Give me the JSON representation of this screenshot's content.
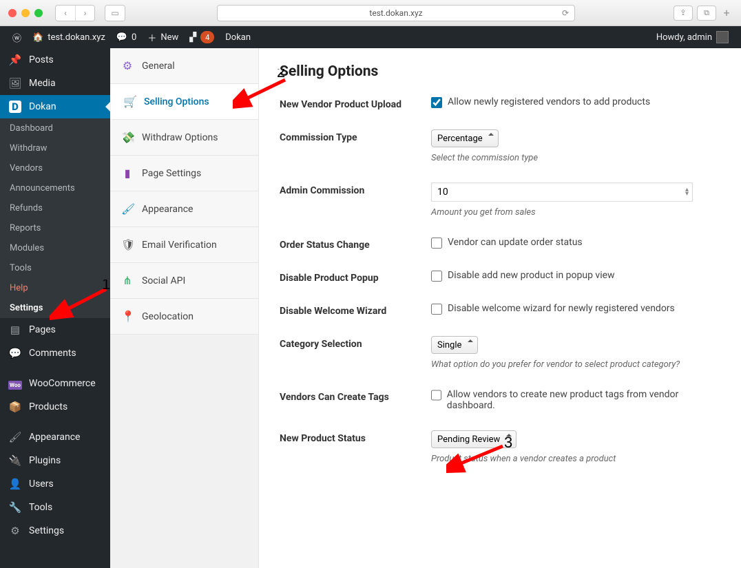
{
  "browser": {
    "url": "test.dokan.xyz"
  },
  "wpbar": {
    "site": "test.dokan.xyz",
    "comments": "0",
    "new": "New",
    "notif": "4",
    "brand": "Dokan",
    "howdy": "Howdy, admin"
  },
  "sidebar": {
    "items": [
      {
        "icon": "📌",
        "label": "Posts"
      },
      {
        "icon": "🖼",
        "label": "Media"
      },
      {
        "icon": "D",
        "label": "Dokan",
        "active": true,
        "sub": [
          {
            "label": "Dashboard"
          },
          {
            "label": "Withdraw"
          },
          {
            "label": "Vendors"
          },
          {
            "label": "Announcements"
          },
          {
            "label": "Refunds"
          },
          {
            "label": "Reports"
          },
          {
            "label": "Modules"
          },
          {
            "label": "Tools"
          },
          {
            "label": "Help",
            "orange": true
          },
          {
            "label": "Settings",
            "active": true
          }
        ]
      },
      {
        "icon": "▤",
        "label": "Pages"
      },
      {
        "icon": "💬",
        "label": "Comments"
      },
      {
        "sep": true
      },
      {
        "icon": "Woo",
        "label": "WooCommerce"
      },
      {
        "icon": "📦",
        "label": "Products"
      },
      {
        "sep": true
      },
      {
        "icon": "🖌",
        "label": "Appearance"
      },
      {
        "icon": "🔌",
        "label": "Plugins"
      },
      {
        "icon": "👤",
        "label": "Users"
      },
      {
        "icon": "🔧",
        "label": "Tools"
      },
      {
        "icon": "⚙",
        "label": "Settings"
      }
    ]
  },
  "tabs": [
    {
      "icon": "⚙",
      "color": "#8a63d2",
      "label": "General"
    },
    {
      "icon": "🛒",
      "color": "#0073aa",
      "label": "Selling Options",
      "active": true
    },
    {
      "icon": "💸",
      "color": "#f05025",
      "label": "Withdraw Options"
    },
    {
      "icon": "▮",
      "color": "#8e44ad",
      "label": "Page Settings"
    },
    {
      "icon": "🖌",
      "color": "#1a89c1",
      "label": "Appearance"
    },
    {
      "icon": "🛡",
      "color": "#555",
      "label": "Email Verification"
    },
    {
      "icon": "⋔",
      "color": "#27ae60",
      "label": "Social API"
    },
    {
      "icon": "📍",
      "color": "#888",
      "label": "Geolocation"
    }
  ],
  "page": {
    "title": "Selling Options",
    "fields": {
      "vendor_upload": {
        "label": "New Vendor Product Upload",
        "checkbox_label": "Allow newly registered vendors to add products",
        "checked": true
      },
      "commission_type": {
        "label": "Commission Type",
        "value": "Percentage",
        "desc": "Select the commission type"
      },
      "admin_commission": {
        "label": "Admin Commission",
        "value": "10",
        "desc": "Amount you get from sales"
      },
      "order_status": {
        "label": "Order Status Change",
        "checkbox_label": "Vendor can update order status",
        "checked": false
      },
      "disable_popup": {
        "label": "Disable Product Popup",
        "checkbox_label": "Disable add new product in popup view",
        "checked": false
      },
      "disable_wizard": {
        "label": "Disable Welcome Wizard",
        "checkbox_label": "Disable welcome wizard for newly registered vendors",
        "checked": false
      },
      "category": {
        "label": "Category Selection",
        "value": "Single",
        "desc": "What option do you prefer for vendor to select product category?"
      },
      "create_tags": {
        "label": "Vendors Can Create Tags",
        "checkbox_label": "Allow vendors to create new product tags from vendor dashboard.",
        "checked": false
      },
      "new_status": {
        "label": "New Product Status",
        "value": "Pending Review",
        "desc": "Product status when a vendor creates a product"
      }
    }
  },
  "annotations": {
    "a1": "1",
    "a2": "2",
    "a3": "3"
  }
}
